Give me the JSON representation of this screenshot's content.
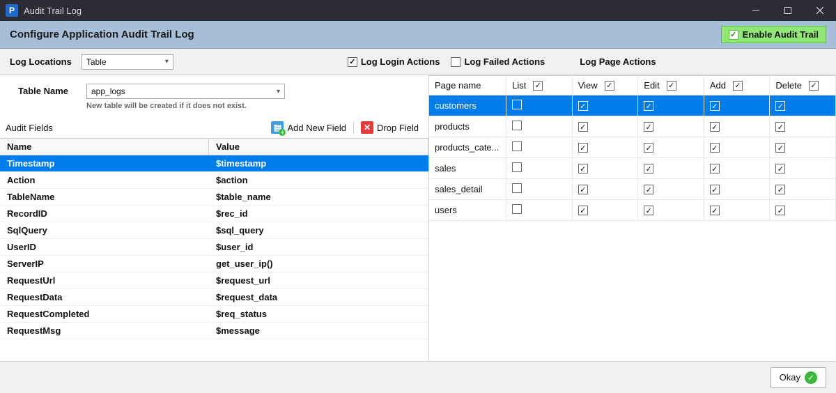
{
  "titlebar": {
    "app_letter": "P",
    "title": "Audit Trail Log"
  },
  "header": {
    "title": "Configure Application Audit Trail Log",
    "enable_label": "Enable Audit Trail",
    "enabled": true
  },
  "toolbar": {
    "log_locations_label": "Log Locations",
    "log_locations_value": "Table",
    "log_login_label": "Log Login Actions",
    "log_login_checked": true,
    "log_failed_label": "Log Failed Actions",
    "log_failed_checked": false,
    "log_page_actions_label": "Log Page Actions"
  },
  "table_name": {
    "label": "Table Name",
    "value": "app_logs",
    "note": "New table will be created if it does not exist."
  },
  "audit_fields": {
    "section_label": "Audit Fields",
    "add_label": "Add New Field",
    "drop_label": "Drop Field",
    "columns": {
      "name": "Name",
      "value": "Value"
    },
    "rows": [
      {
        "name": "Timestamp",
        "value": "$timestamp",
        "selected": true
      },
      {
        "name": "Action",
        "value": "$action"
      },
      {
        "name": "TableName",
        "value": "$table_name"
      },
      {
        "name": "RecordID",
        "value": "$rec_id"
      },
      {
        "name": "SqlQuery",
        "value": "$sql_query"
      },
      {
        "name": "UserID",
        "value": "$user_id"
      },
      {
        "name": "ServerIP",
        "value": "get_user_ip()"
      },
      {
        "name": "RequestUrl",
        "value": "$request_url"
      },
      {
        "name": "RequestData",
        "value": "$request_data"
      },
      {
        "name": "RequestCompleted",
        "value": "$req_status"
      },
      {
        "name": "RequestMsg",
        "value": "$message"
      }
    ]
  },
  "page_actions": {
    "columns": {
      "page": "Page name",
      "list": "List",
      "view": "View",
      "edit": "Edit",
      "add": "Add",
      "delete": "Delete"
    },
    "header_checks": {
      "list": true,
      "view": true,
      "edit": true,
      "add": true,
      "delete": true
    },
    "rows": [
      {
        "page": "customers",
        "list": false,
        "view": true,
        "edit": true,
        "add": true,
        "delete": true,
        "selected": true
      },
      {
        "page": "products",
        "list": false,
        "view": true,
        "edit": true,
        "add": true,
        "delete": true
      },
      {
        "page": "products_cate...",
        "list": false,
        "view": true,
        "edit": true,
        "add": true,
        "delete": true
      },
      {
        "page": "sales",
        "list": false,
        "view": true,
        "edit": true,
        "add": true,
        "delete": true
      },
      {
        "page": "sales_detail",
        "list": false,
        "view": true,
        "edit": true,
        "add": true,
        "delete": true
      },
      {
        "page": "users",
        "list": false,
        "view": true,
        "edit": true,
        "add": true,
        "delete": true
      }
    ]
  },
  "footer": {
    "okay": "Okay"
  }
}
